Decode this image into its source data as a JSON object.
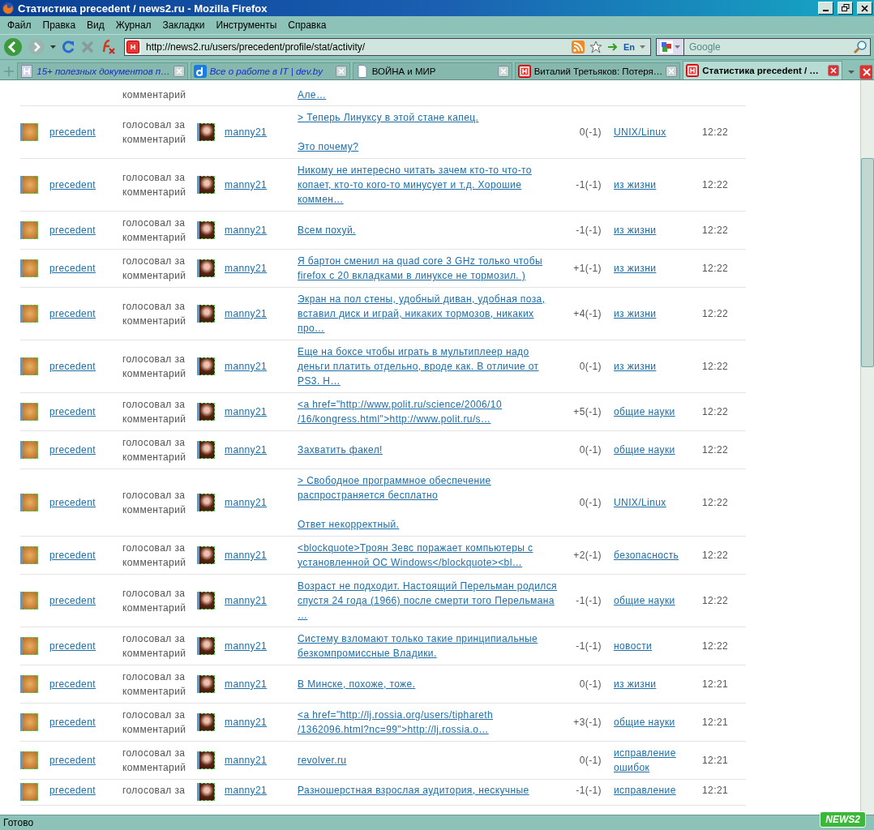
{
  "window": {
    "title": "Статистика precedent / news2.ru - Mozilla Firefox"
  },
  "menu": [
    "Файл",
    "Правка",
    "Вид",
    "Журнал",
    "Закладки",
    "Инструменты",
    "Справка"
  ],
  "navbar": {
    "url": "http://news2.ru/users/precedent/profile/stat/activity/",
    "language": "En",
    "search": {
      "placeholder": "Google"
    }
  },
  "tabs": [
    {
      "title": "15+ полезных документов п…",
      "unread": true,
      "selected": false
    },
    {
      "title": "Все о работе в IT | dev.by",
      "unread": true,
      "selected": false
    },
    {
      "title": "ВОЙНА и МИР",
      "unread": false,
      "selected": false
    },
    {
      "title": "Виталий Третьяков: Потеря…",
      "unread": false,
      "selected": false
    },
    {
      "title": "Статистика precedent / …",
      "unread": false,
      "selected": true
    }
  ],
  "rows": [
    {
      "kind": "partial-top",
      "action": [
        "комментарий"
      ],
      "comment": [
        [
          "Але…"
        ]
      ]
    },
    {
      "kind": "full",
      "user": "precedent",
      "action": [
        "голосовал за",
        "комментарий"
      ],
      "target": "manny21",
      "comment": [
        [
          "> Теперь Линуксу в этой стане капец."
        ],
        [
          "Это почему?"
        ]
      ],
      "rating": "0(-1)",
      "category": [
        "UNIX/Linux"
      ],
      "time": "12:22"
    },
    {
      "kind": "full",
      "user": "precedent",
      "action": [
        "голосовал за",
        "комментарий"
      ],
      "target": "manny21",
      "comment": [
        [
          "Никому не интересно читать зачем кто-то что-то",
          "копает, кто-то кого-то минусует и т.д. Хорошие",
          "коммен…"
        ]
      ],
      "rating": "-1(-1)",
      "category": [
        "из жизни"
      ],
      "time": "12:22"
    },
    {
      "kind": "full",
      "user": "precedent",
      "action": [
        "голосовал за",
        "комментарий"
      ],
      "target": "manny21",
      "comment": [
        [
          "Всем похуй."
        ]
      ],
      "rating": "-1(-1)",
      "category": [
        "из жизни"
      ],
      "time": "12:22"
    },
    {
      "kind": "full",
      "user": "precedent",
      "action": [
        "голосовал за",
        "комментарий"
      ],
      "target": "manny21",
      "comment": [
        [
          "Я бартон сменил на quad core 3 GHz только чтобы",
          "firefox с 20 вкладками в линуксе не тормозил. )"
        ]
      ],
      "rating": "+1(-1)",
      "category": [
        "из жизни"
      ],
      "time": "12:22"
    },
    {
      "kind": "full",
      "user": "precedent",
      "action": [
        "голосовал за",
        "комментарий"
      ],
      "target": "manny21",
      "comment": [
        [
          "Экран на пол стены, удобный диван, удобная поза,",
          "вставил диск и играй, никаких тормозов, никаких",
          "про…"
        ]
      ],
      "rating": "+4(-1)",
      "category": [
        "из жизни"
      ],
      "time": "12:22"
    },
    {
      "kind": "full",
      "user": "precedent",
      "action": [
        "голосовал за",
        "комментарий"
      ],
      "target": "manny21",
      "comment": [
        [
          "Еще на боксе чтобы играть в мультиплеер надо",
          "деньги платить отдельно, вроде как. В отличие от",
          "PS3. Н…"
        ]
      ],
      "rating": "0(-1)",
      "category": [
        "из жизни"
      ],
      "time": "12:22"
    },
    {
      "kind": "full",
      "user": "precedent",
      "action": [
        "голосовал за",
        "комментарий"
      ],
      "target": "manny21",
      "comment": [
        [
          "<a href=\"http://www.polit.ru/science/2006/10",
          "/16/kongress.html\">http://www.polit.ru/s…"
        ]
      ],
      "rating": "+5(-1)",
      "category": [
        "общие науки"
      ],
      "time": "12:22"
    },
    {
      "kind": "full",
      "user": "precedent",
      "action": [
        "голосовал за",
        "комментарий"
      ],
      "target": "manny21",
      "comment": [
        [
          "Захватить факел!"
        ]
      ],
      "rating": "0(-1)",
      "category": [
        "общие науки"
      ],
      "time": "12:22"
    },
    {
      "kind": "full",
      "user": "precedent",
      "action": [
        "голосовал за",
        "комментарий"
      ],
      "target": "manny21",
      "comment": [
        [
          "> Свободное программное обеспечение",
          "распространяется бесплатно"
        ],
        [
          "Ответ некорректный."
        ]
      ],
      "rating": "0(-1)",
      "category": [
        "UNIX/Linux"
      ],
      "time": "12:22"
    },
    {
      "kind": "full",
      "user": "precedent",
      "action": [
        "голосовал за",
        "комментарий"
      ],
      "target": "manny21",
      "comment": [
        [
          "<blockquote>Троян Зевс поражает компьютеры с",
          "установленной ОС Windows</blockquote><bl…"
        ]
      ],
      "rating": "+2(-1)",
      "category": [
        "безопасность"
      ],
      "time": "12:22"
    },
    {
      "kind": "full",
      "user": "precedent",
      "action": [
        "голосовал за",
        "комментарий"
      ],
      "target": "manny21",
      "comment": [
        [
          "Возраст не подходит. Настоящий Перельман родился",
          "спустя 24 года (1966) после смерти того Перельмана",
          "…"
        ]
      ],
      "rating": "-1(-1)",
      "category": [
        "общие науки"
      ],
      "time": "12:22"
    },
    {
      "kind": "full",
      "user": "precedent",
      "action": [
        "голосовал за",
        "комментарий"
      ],
      "target": "manny21",
      "comment": [
        [
          "Систему взломают только такие принципиальные",
          "безкомпромиссные Владики."
        ]
      ],
      "rating": "-1(-1)",
      "category": [
        "новости"
      ],
      "time": "12:22"
    },
    {
      "kind": "full",
      "user": "precedent",
      "action": [
        "голосовал за",
        "комментарий"
      ],
      "target": "manny21",
      "comment": [
        [
          "В Минске, похоже, тоже."
        ]
      ],
      "rating": "0(-1)",
      "category": [
        "из жизни"
      ],
      "time": "12:21"
    },
    {
      "kind": "full",
      "user": "precedent",
      "action": [
        "голосовал за",
        "комментарий"
      ],
      "target": "manny21",
      "comment": [
        [
          "<a href=\"http://lj.rossia.org/users/tiphareth",
          "/1362096.html?nc=99\">http://lj.rossia.o…"
        ]
      ],
      "rating": "+3(-1)",
      "category": [
        "общие науки"
      ],
      "time": "12:21"
    },
    {
      "kind": "full",
      "user": "precedent",
      "action": [
        "голосовал за",
        "комментарий"
      ],
      "target": "manny21",
      "comment": [
        [
          "revolver.ru"
        ]
      ],
      "rating": "0(-1)",
      "category": [
        "исправление",
        "ошибок"
      ],
      "time": "12:21"
    },
    {
      "kind": "partial-bottom",
      "user": "precedent",
      "action": [
        "голосовал за"
      ],
      "target": "manny21",
      "comment": [
        [
          "Разношерстная взрослая аудитория, нескучные"
        ]
      ],
      "rating": "-1(-1)",
      "category": [
        "исправление"
      ],
      "time": "12:21"
    }
  ],
  "status_bar": {
    "text": "Готово",
    "badge": "NEWS2"
  }
}
